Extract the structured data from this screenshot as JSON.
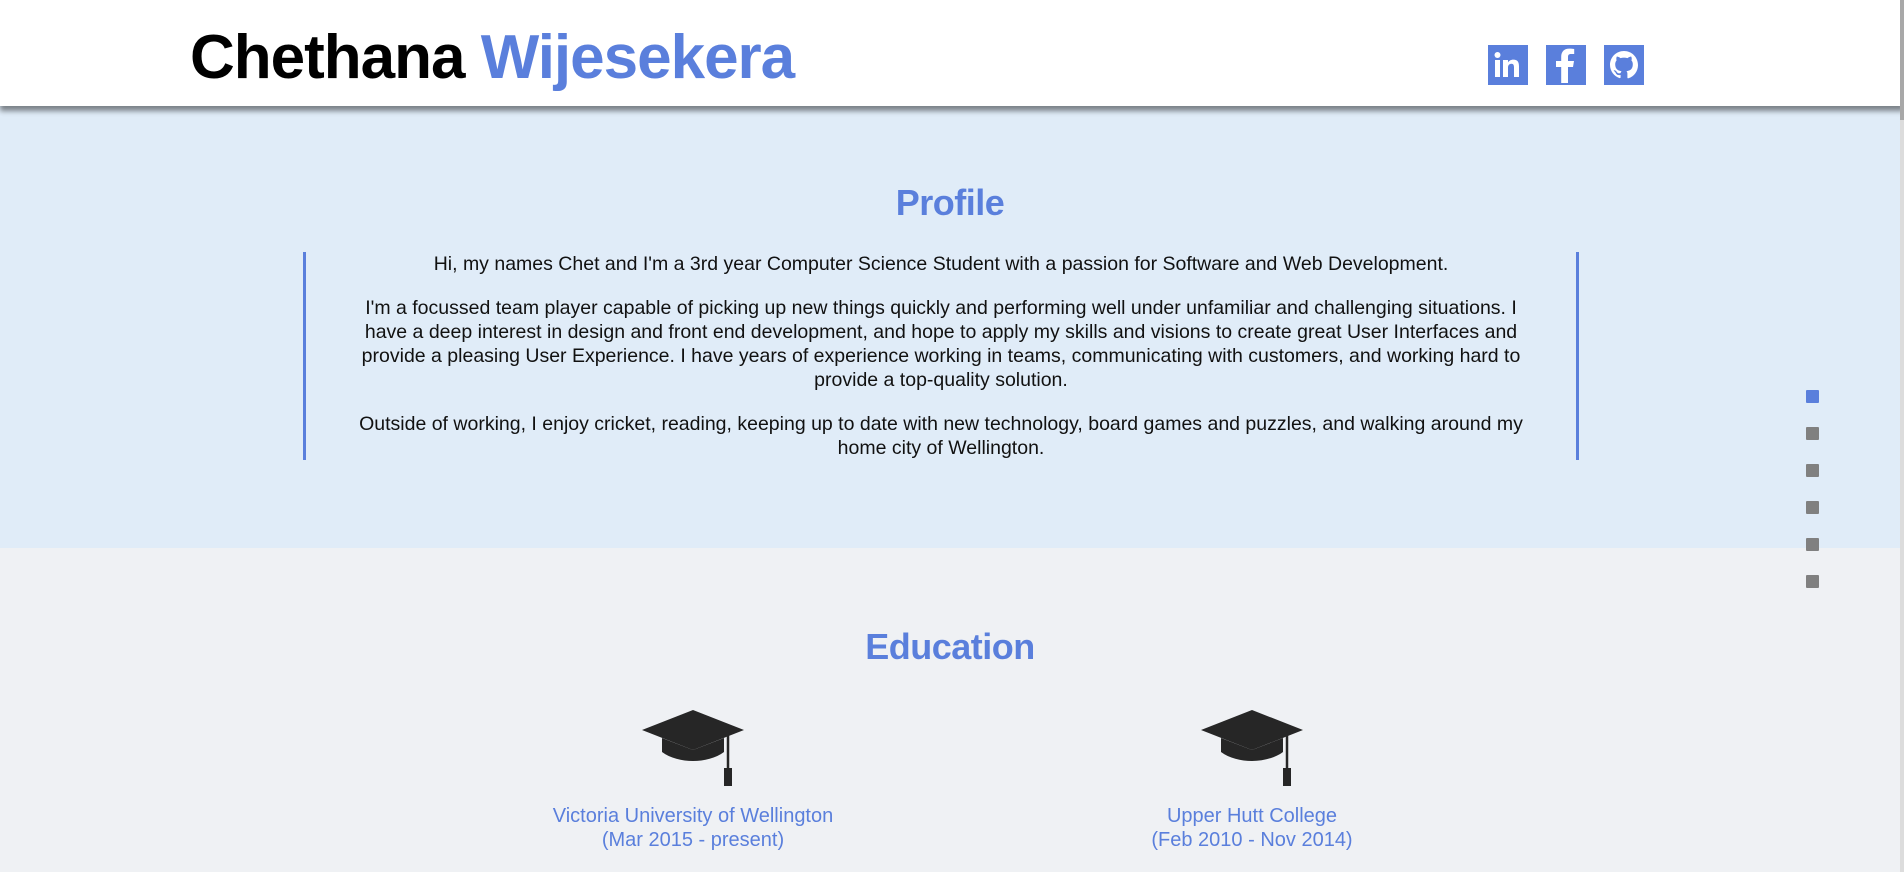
{
  "header": {
    "first_name": "Chethana",
    "last_name": "Wijesekera",
    "social": [
      {
        "name": "linkedin",
        "icon": "linkedin-icon"
      },
      {
        "name": "facebook",
        "icon": "facebook-icon"
      },
      {
        "name": "github",
        "icon": "github-icon"
      }
    ]
  },
  "profile": {
    "title": "Profile",
    "paragraphs": [
      "Hi, my names Chet and I'm a 3rd year Computer Science Student with a passion for Software and Web Development.",
      "I'm a focussed team player capable of picking up new things quickly and performing well under unfamiliar and challenging situations. I have a deep interest in design and front end development, and hope to apply my skills and visions to create great User Interfaces and provide a pleasing User Experience. I have years of experience working in teams, communicating with customers, and working hard to provide a top-quality solution.",
      "Outside of working, I enjoy cricket, reading, keeping up to date with new technology, board games and puzzles, and walking around my home city of Wellington."
    ]
  },
  "education": {
    "title": "Education",
    "items": [
      {
        "school": "Victoria University of Wellington",
        "dates": "(Mar 2015 - present)",
        "icon": "graduation-cap-icon"
      },
      {
        "school": "Upper Hutt College",
        "dates": "(Feb 2010 - Nov 2014)",
        "icon": "graduation-cap-icon"
      }
    ]
  },
  "sidenav": {
    "count": 6,
    "active_index": 0
  },
  "colors": {
    "accent": "#5a7fdc",
    "profile_bg": "#e0ecf8",
    "page_bg": "#eff1f4",
    "header_bg": "#ffffff",
    "dot_inactive": "#808080"
  }
}
